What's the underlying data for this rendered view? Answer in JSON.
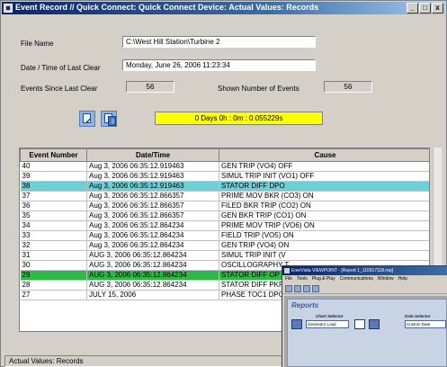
{
  "window": {
    "title": "Event Record // Quick Connect: Quick Connect Device: Actual Values: Records",
    "buttons": [
      "_",
      "□",
      "x"
    ]
  },
  "info": {
    "file_name_label": "File Name",
    "file_name_value": "C:\\West Hill Station\\Turbine 2",
    "last_clear_label": "Date / Time of Last Clear",
    "last_clear_value": "Monday, June 26, 2006 11:23:34",
    "events_since_label": "Events Since Last Clear",
    "events_since_value": "56",
    "shown_events_label": "Shown Number of Events",
    "shown_events_value": "56"
  },
  "timer": {
    "text": "0 Days 0h :  0m :  0.055229s"
  },
  "table": {
    "headers": [
      "Event Number",
      "Date/Time",
      "Cause"
    ],
    "rows": [
      {
        "n": "40",
        "dt": "Aug 3, 2006 06:35:12.919463",
        "cause": "GEN TRIP (VO4) OFF"
      },
      {
        "n": "39",
        "dt": "Aug 3, 2006 06:35:12.919463",
        "cause": "SIMUL TRIP INIT (VO1) OFF"
      },
      {
        "n": "38",
        "dt": "Aug 3, 2006 06:35:12.919463",
        "cause": "STATOR DIFF DPO"
      },
      {
        "n": "37",
        "dt": "Aug 3, 2006 06:35:12.866357",
        "cause": "PRIME MOV BKR (CO3) ON"
      },
      {
        "n": "36",
        "dt": "Aug 3, 2006 06:35:12.866357",
        "cause": "FILED BKR TRIP (CO2) ON"
      },
      {
        "n": "35",
        "dt": "Aug 3, 2006 06:35:12.866357",
        "cause": "GEN BKR TRIP (CO1) ON"
      },
      {
        "n": "34",
        "dt": "Aug 3, 2006 06:35:12.864234",
        "cause": "PRIME MOV TRIP (VO6) ON"
      },
      {
        "n": "33",
        "dt": "Aug 3, 2006 06:35:12.864234",
        "cause": "FIELD TRIP (VO5) ON"
      },
      {
        "n": "32",
        "dt": "Aug 3, 2006 06:35:12.864234",
        "cause": "GEN TRIP (VO4) ON"
      },
      {
        "n": "31",
        "dt": "AUG 3, 2006 06:35:12.864234",
        "cause": "SIMUL TRIP INIT (V"
      },
      {
        "n": "30",
        "dt": "AUG 3, 2006 06:35:12.864234",
        "cause": "OSCILLOGRAPHY T"
      },
      {
        "n": "29",
        "dt": "AUG 3, 2006 06:35:12.864234",
        "cause": "STATOR DIFF OP"
      },
      {
        "n": "28",
        "dt": "AUG 3, 2006 06:35:12.864234",
        "cause": "STATOR DIFF PKP"
      },
      {
        "n": "27",
        "dt": "JULY 15, 2006",
        "cause": "PHASE TOC1 DPO"
      }
    ],
    "highlight_colors": {
      "38": "#6fcfd6",
      "29": "#2fb84a"
    }
  },
  "status": {
    "text": "Actual Values: Records"
  },
  "overlay": {
    "title": "EnerVista VIEWPOINT - [Report 1_110917118.rep]",
    "menu": [
      "File",
      "Tools",
      "Plug & Play",
      "Communications",
      "Window",
      "Help"
    ],
    "panel_title": "Reports",
    "chart_selector_label": "Chart Selector",
    "chart_selector_value": "Generator Load",
    "date_selector_label": "Date Selector",
    "date_selector_value": "Custom Date"
  }
}
